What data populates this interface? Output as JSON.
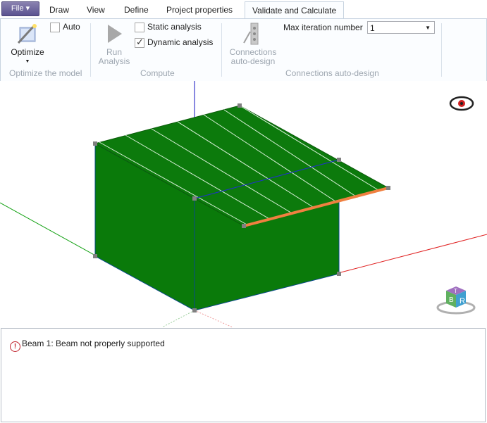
{
  "menu": {
    "file_label": "File ▾",
    "tabs": [
      "Draw",
      "View",
      "Define",
      "Project properties"
    ],
    "active_tab": "Validate and Calculate"
  },
  "ribbon": {
    "optimize": {
      "button_label": "Optimize",
      "auto_label": "Auto",
      "auto_checked": false,
      "group_label": "Optimize the model"
    },
    "compute": {
      "run_label_1": "Run",
      "run_label_2": "Analysis",
      "static_label": "Static analysis",
      "static_checked": false,
      "dynamic_label": "Dynamic analysis",
      "dynamic_checked": true,
      "group_label": "Compute"
    },
    "connections": {
      "button_label_1": "Connections",
      "button_label_2": "auto-design",
      "max_iter_label": "Max iteration number",
      "max_iter_value": "1",
      "group_label": "Connections auto-design"
    }
  },
  "viewport": {
    "visibility_icon": "eye-crossed-icon",
    "view_cube_labels": [
      "R",
      "B",
      "T"
    ],
    "colors": {
      "roof": "#0c7a0c",
      "wall": "#0a7a0a",
      "beam": "#f08040",
      "x_axis": "#e02020",
      "y_axis": "#10a010",
      "z_axis": "#1010c0"
    }
  },
  "messages": [
    {
      "icon": "error-icon",
      "text": "Beam 1: Beam not properly supported"
    }
  ]
}
